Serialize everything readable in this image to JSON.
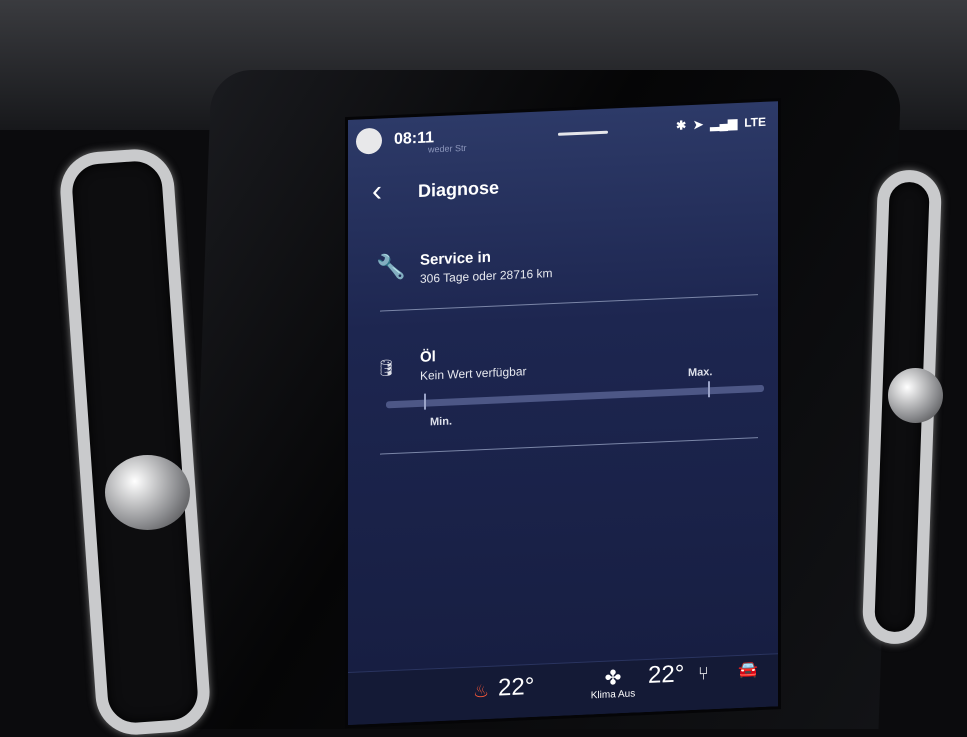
{
  "status": {
    "time": "08:11",
    "street": "weder Str",
    "signal": "LTE"
  },
  "header": {
    "back_icon": "chevron-left-icon",
    "title": "Diagnose"
  },
  "service": {
    "label": "Service in",
    "value": "306 Tage oder 28716 km",
    "icon": "wrench-icon"
  },
  "oil": {
    "label": "Öl",
    "value": "Kein Wert verfügbar",
    "icon": "oil-can-icon",
    "min_label": "Min.",
    "max_label": "Max.",
    "level": 0
  },
  "climate": {
    "left_temp": "22°",
    "fan_label": "Klima Aus",
    "right_temp": "22°"
  },
  "colors": {
    "screen_bg": "#1d2650",
    "accent": "#7f89b8",
    "seat_heat": "#ff5a3a"
  }
}
